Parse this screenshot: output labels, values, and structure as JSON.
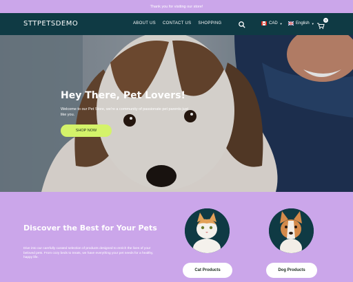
{
  "announcement": {
    "text": "Thank you for visiting our store!"
  },
  "header": {
    "logo": "STTPETSDEMO",
    "menu": [
      {
        "label": "ABOUT US"
      },
      {
        "label": "CONTACT US"
      },
      {
        "label": "SHOPPING"
      }
    ],
    "search_icon": "search-icon",
    "currency": {
      "label": "CAD",
      "flag": "canada-flag-icon"
    },
    "language": {
      "label": "English",
      "flag": "uk-flag-icon"
    },
    "cart": {
      "icon": "cart-icon",
      "count": "0"
    }
  },
  "hero": {
    "title": "Hey There, Pet Lovers!",
    "text": "Welcome to our Pet Store, we're a community of passionate pet parents just like you.",
    "button": "SHOP NOW"
  },
  "discover": {
    "title": "Discover the Best for Your Pets",
    "text": "Dive into our carefully curated selection of products designed to enrich the lives of your beloved pets. From cozy beds to treats, we have everything your pet needs for a healthy, happy life.",
    "categories": [
      {
        "label": "Cat Products",
        "image": "cat-photo"
      },
      {
        "label": "Dog Products",
        "image": "dog-photo"
      }
    ]
  },
  "colors": {
    "nav_bg": "#0f3a44",
    "lavender": "#cba6ea",
    "cta_green": "#d4f36a"
  }
}
